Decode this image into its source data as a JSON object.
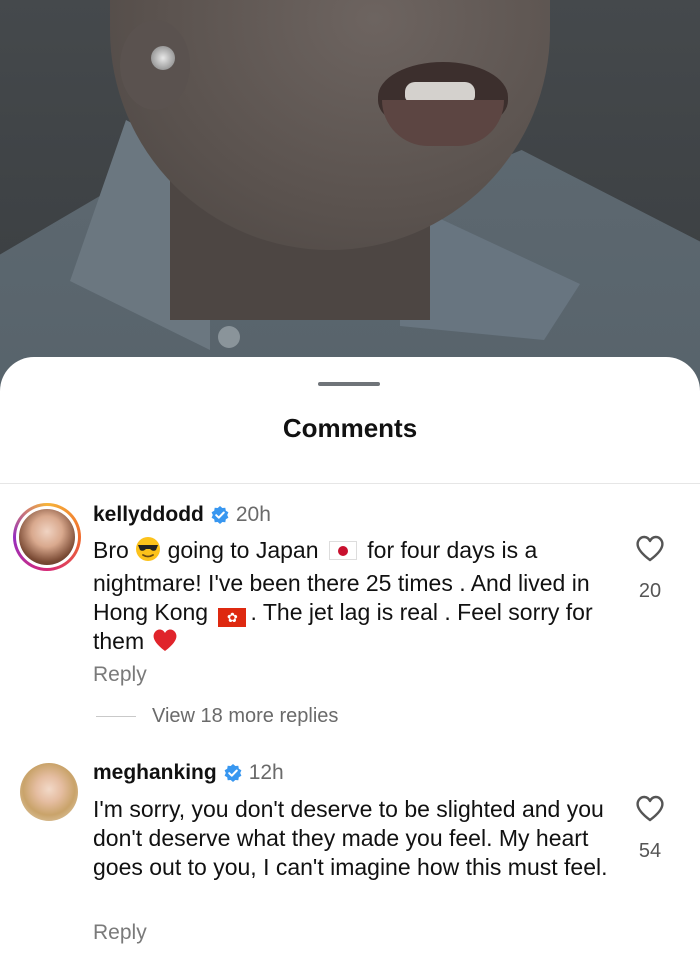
{
  "sheet": {
    "title": "Comments"
  },
  "comments": [
    {
      "username": "kellyddodd",
      "time": "20h",
      "text_parts": [
        "Bro",
        "going to Japan",
        "for four days is a nightmare! I've been there  25 times . And lived in Hong Kong",
        ". The jet lag is real . Feel sorry for them"
      ],
      "likes": "20",
      "reply_label": "Reply",
      "view_more": "View 18 more replies"
    },
    {
      "username": "meghanking",
      "time": "12h",
      "text": "I'm sorry, you don't deserve to be slighted and you don't deserve what they made you feel. My heart goes out to you, I can't imagine how this must feel.",
      "likes": "54",
      "reply_label": "Reply"
    }
  ],
  "colors": {
    "verified": "#3897f0",
    "muted": "#6a6a6a"
  },
  "icons": [
    "verified-icon",
    "heart-outline-icon",
    "sunglasses-emoji",
    "japan-flag-emoji",
    "hong-kong-flag-emoji",
    "red-heart-emoji"
  ]
}
